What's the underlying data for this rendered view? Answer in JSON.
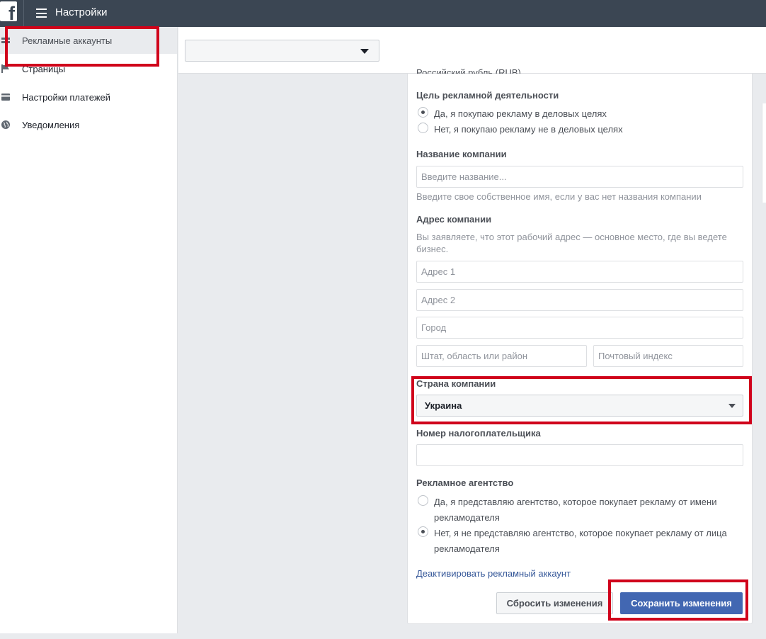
{
  "header": {
    "title": "Настройки",
    "logo_letter": "f"
  },
  "sidebar": {
    "items": [
      {
        "label": "Рекламные аккаунты",
        "icon": "ad-accounts-icon",
        "active": true
      },
      {
        "label": "Страницы",
        "icon": "flag-icon",
        "active": false
      },
      {
        "label": "Настройки платежей",
        "icon": "credit-card-icon",
        "active": false
      },
      {
        "label": "Уведомления",
        "icon": "globe-icon",
        "active": false
      }
    ]
  },
  "account_selector": {
    "value": ""
  },
  "form": {
    "currency_cut": "Российский рубль (RUB)",
    "purpose": {
      "label": "Цель рекламной деятельности",
      "options": [
        {
          "label": "Да, я покупаю рекламу в деловых целях",
          "checked": true
        },
        {
          "label": "Нет, я покупаю рекламу не в деловых целях",
          "checked": false
        }
      ]
    },
    "company_name": {
      "label": "Название компании",
      "placeholder": "Введите название...",
      "hint": "Введите свое собственное имя, если у вас нет названия компании"
    },
    "address": {
      "label": "Адрес компании",
      "hint": "Вы заявляете, что этот рабочий адрес — основное место, где вы ведете бизнес.",
      "line1_placeholder": "Адрес 1",
      "line2_placeholder": "Адрес 2",
      "city_placeholder": "Город",
      "state_placeholder": "Штат, область или район",
      "zip_placeholder": "Почтовый индекс"
    },
    "country": {
      "label": "Страна компании",
      "value": "Украина"
    },
    "tax_id": {
      "label": "Номер налогоплательщика",
      "value": ""
    },
    "agency": {
      "label": "Рекламное агентство",
      "options": [
        {
          "label": "Да, я представляю агентство, которое покупает рекламу от имени рекламодателя",
          "checked": false
        },
        {
          "label": "Нет, я не представляю агентство, которое покупает рекламу от лица рекламодателя",
          "checked": true
        }
      ]
    },
    "deactivate_link": "Деактивировать рекламный аккаунт",
    "reset_label": "Сбросить изменения",
    "save_label": "Сохранить изменения"
  },
  "colors": {
    "highlight": "#d0021b",
    "primary": "#4267b2",
    "topbar": "#3b4653"
  }
}
